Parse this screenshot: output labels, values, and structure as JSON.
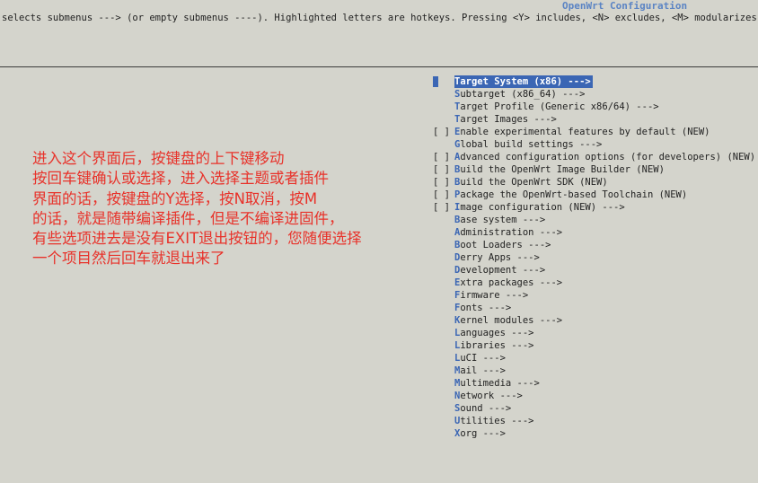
{
  "window": {
    "title": "OpenWrt Configuration"
  },
  "help": {
    "text": "selects submenus ---> (or empty submenus ----).  Highlighted letters are hotkeys.  Pressing <Y> includes, <N> excludes, <M> modularizes featu"
  },
  "annotation": {
    "lines": [
      "进入这个界面后，按键盘的上下键移动",
      "按回车键确认或选择，进入选择主题或者插件",
      "界面的话，按键盘的Y选择，按N取消，按M",
      "的话，就是随带编译插件，但是不编译进固件，",
      "有些选项进去是没有EXIT退出按钮的，您随便选择",
      "一个项目然后回车就退出来了"
    ]
  },
  "menu": {
    "items": [
      {
        "check": "",
        "hot": "T",
        "rest": "arget System (x86)  --->",
        "selected": true
      },
      {
        "check": "",
        "hot": "S",
        "rest": "ubtarget (x86_64)  --->",
        "selected": false
      },
      {
        "check": "",
        "hot": "T",
        "rest": "arget Profile (Generic x86/64)  --->",
        "selected": false
      },
      {
        "check": "",
        "hot": "T",
        "rest": "arget Images  --->",
        "selected": false
      },
      {
        "check": "[ ]",
        "hot": "E",
        "rest": "nable experimental features by default (NEW)",
        "selected": false
      },
      {
        "check": "",
        "hot": "G",
        "rest": "lobal build settings  --->",
        "selected": false
      },
      {
        "check": "[ ]",
        "hot": "A",
        "rest": "dvanced configuration options (for developers) (NEW)  -",
        "selected": false
      },
      {
        "check": "[ ]",
        "hot": "B",
        "rest": "uild the OpenWrt Image Builder (NEW)",
        "selected": false
      },
      {
        "check": "[ ]",
        "hot": "B",
        "rest": "uild the OpenWrt SDK (NEW)",
        "selected": false
      },
      {
        "check": "[ ]",
        "hot": "P",
        "rest": "ackage the OpenWrt-based Toolchain (NEW)",
        "selected": false
      },
      {
        "check": "[ ]",
        "hot": "I",
        "rest": "mage configuration (NEW)  --->",
        "selected": false
      },
      {
        "check": "",
        "hot": "B",
        "rest": "ase system  --->",
        "selected": false
      },
      {
        "check": "",
        "hot": "A",
        "rest": "dministration  --->",
        "selected": false
      },
      {
        "check": "",
        "hot": "B",
        "rest": "oot Loaders  --->",
        "selected": false
      },
      {
        "check": "",
        "hot": "D",
        "rest": "erry Apps  --->",
        "selected": false
      },
      {
        "check": "",
        "hot": "D",
        "rest": "evelopment  --->",
        "selected": false
      },
      {
        "check": "",
        "hot": "E",
        "rest": "xtra packages  --->",
        "selected": false
      },
      {
        "check": "",
        "hot": "F",
        "rest": "irmware  --->",
        "selected": false
      },
      {
        "check": "",
        "hot": "F",
        "rest": "onts  --->",
        "selected": false
      },
      {
        "check": "",
        "hot": "K",
        "rest": "ernel modules  --->",
        "selected": false
      },
      {
        "check": "",
        "hot": "L",
        "rest": "anguages  --->",
        "selected": false
      },
      {
        "check": "",
        "hot": "L",
        "rest": "ibraries  --->",
        "selected": false
      },
      {
        "check": "",
        "hot": "L",
        "rest": "uCI  --->",
        "selected": false
      },
      {
        "check": "",
        "hot": "M",
        "rest": "ail  --->",
        "selected": false
      },
      {
        "check": "",
        "hot": "M",
        "rest": "ultimedia  --->",
        "selected": false
      },
      {
        "check": "",
        "hot": "N",
        "rest": "etwork  --->",
        "selected": false
      },
      {
        "check": "",
        "hot": "S",
        "rest": "ound  --->",
        "selected": false
      },
      {
        "check": "",
        "hot": "U",
        "rest": "tilities  --->",
        "selected": false
      },
      {
        "check": "",
        "hot": "X",
        "rest": "org  --->",
        "selected": false
      }
    ]
  }
}
